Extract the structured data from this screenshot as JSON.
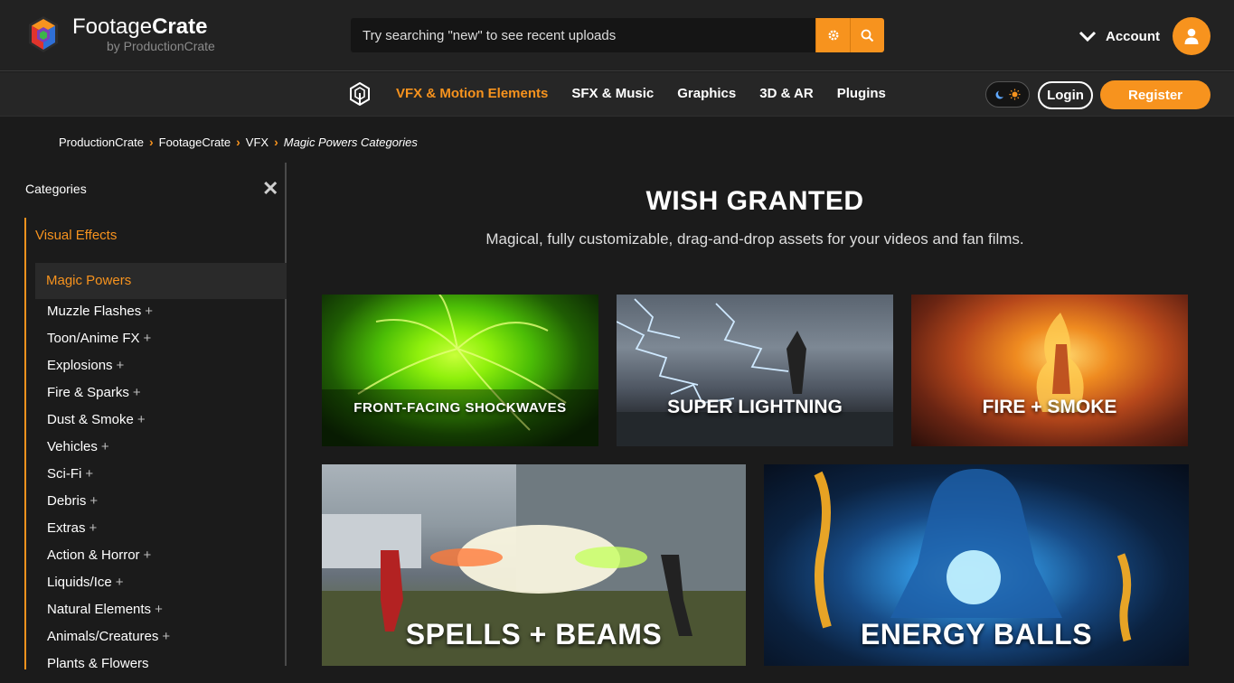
{
  "header": {
    "brand_main": "Footage",
    "brand_bold": "Crate",
    "brand_sub": "by ProductionCrate",
    "search_placeholder": "Try searching \"new\" to see recent uploads",
    "account_label": "Account"
  },
  "nav": {
    "items": [
      {
        "label": "VFX & Motion Elements",
        "active": true
      },
      {
        "label": "SFX & Music",
        "active": false
      },
      {
        "label": "Graphics",
        "active": false
      },
      {
        "label": "3D & AR",
        "active": false
      },
      {
        "label": "Plugins",
        "active": false
      }
    ],
    "login_label": "Login",
    "register_label": "Register"
  },
  "breadcrumb": {
    "items": [
      "ProductionCrate",
      "FootageCrate",
      "VFX"
    ],
    "current": "Magic Powers Categories"
  },
  "sidebar": {
    "title": "Categories",
    "close_glyph": "✕",
    "parent": "Visual Effects",
    "active": "Magic Powers",
    "items": [
      "Muzzle Flashes",
      "Toon/Anime FX",
      "Explosions",
      "Fire & Sparks",
      "Dust & Smoke",
      "Vehicles",
      "Sci-Fi",
      "Debris",
      "Extras",
      "Action & Horror",
      "Liquids/Ice",
      "Natural Elements",
      "Animals/Creatures",
      "Plants & Flowers"
    ],
    "plus_glyph": "+"
  },
  "main": {
    "title": "WISH GRANTED",
    "subtitle": "Magical, fully customizable, drag-and-drop assets for your videos and fan films.",
    "cards": [
      {
        "label": "FRONT-FACING SHOCKWAVES"
      },
      {
        "label": "SUPER LIGHTNING"
      },
      {
        "label": "FIRE + SMOKE"
      },
      {
        "label": "SPELLS + BEAMS"
      },
      {
        "label": "ENERGY BALLS"
      }
    ]
  },
  "colors": {
    "accent": "#f7931e",
    "background": "#1b1b1b",
    "header": "#222222"
  }
}
